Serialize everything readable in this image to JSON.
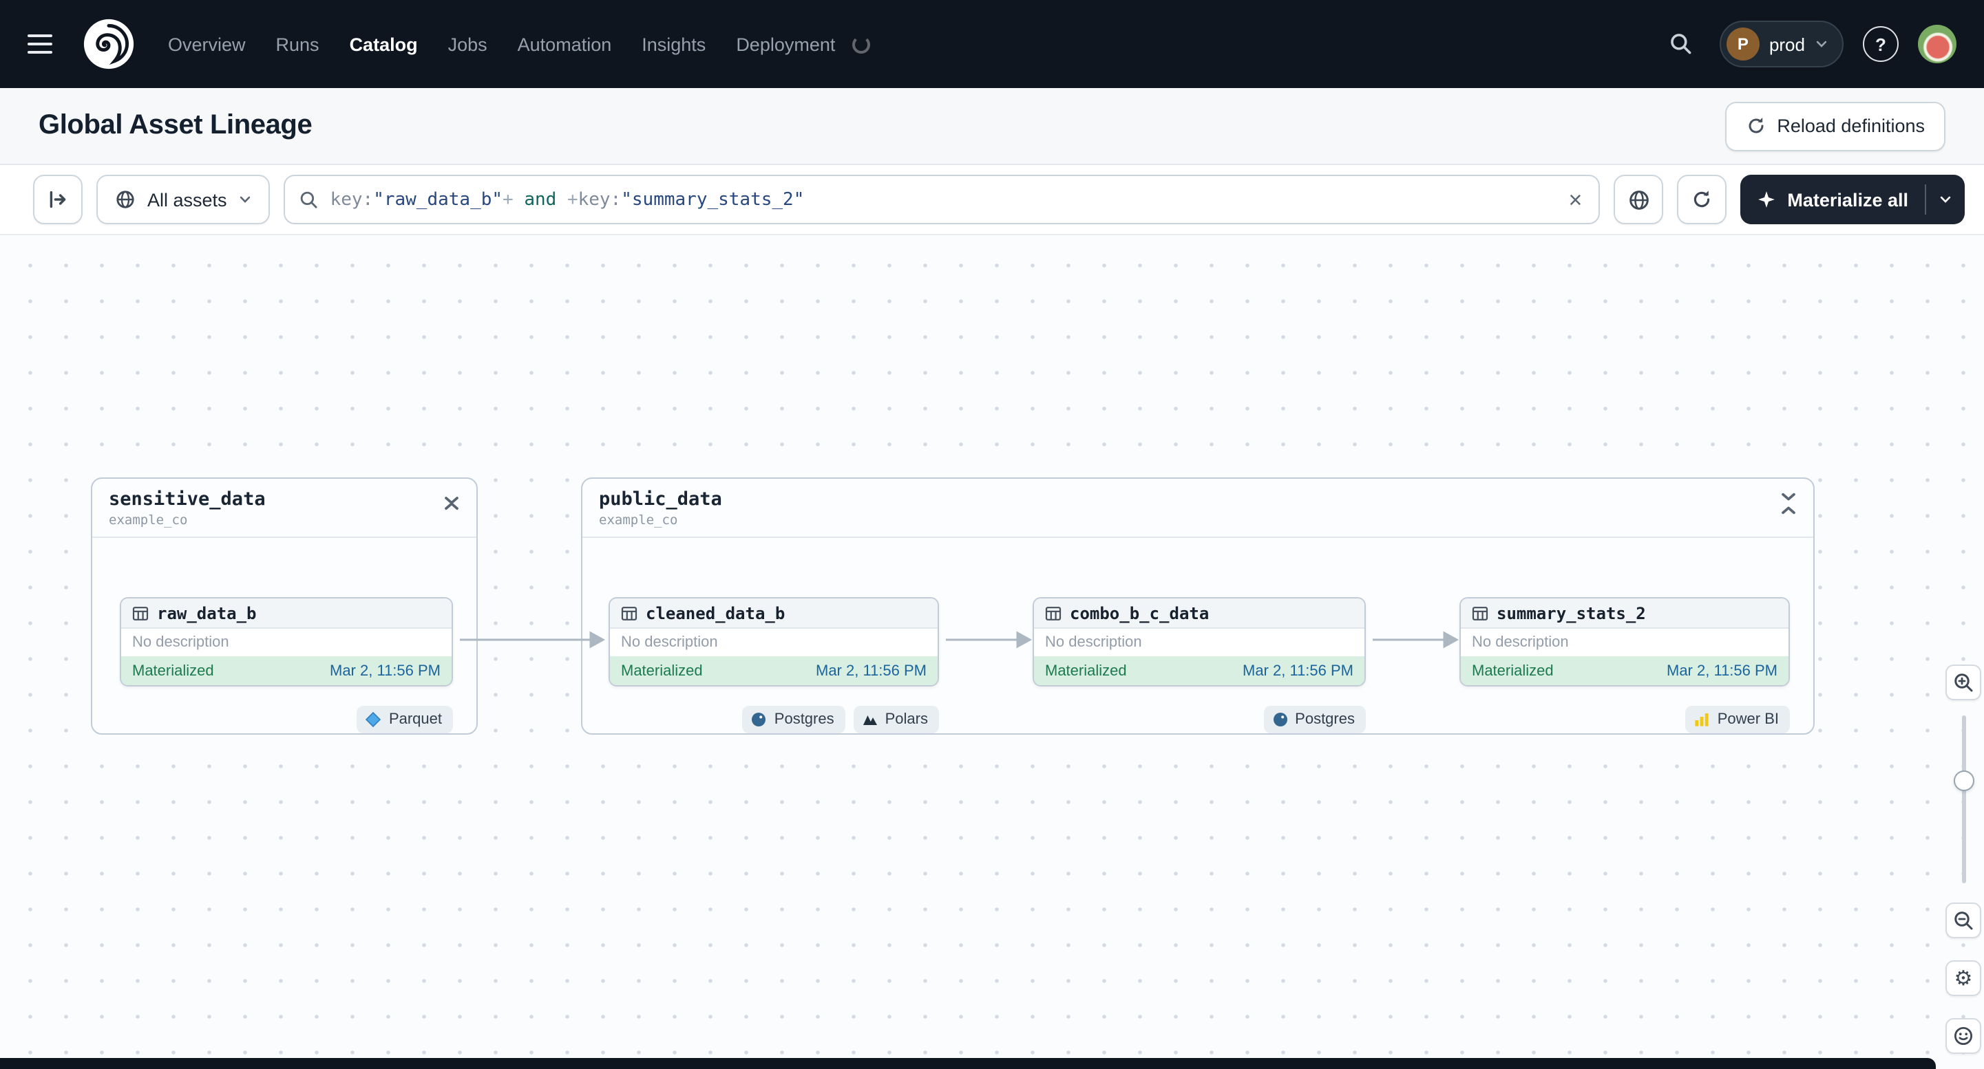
{
  "icons": {
    "close": "×",
    "help": "?",
    "gear": "⚙"
  },
  "navbar": {
    "items": [
      {
        "label": "Overview"
      },
      {
        "label": "Runs"
      },
      {
        "label": "Catalog"
      },
      {
        "label": "Jobs"
      },
      {
        "label": "Automation"
      },
      {
        "label": "Insights"
      },
      {
        "label": "Deployment"
      }
    ],
    "deployment": {
      "initial": "P",
      "label": "prod"
    }
  },
  "header": {
    "title": "Global Asset Lineage",
    "reload_label": "Reload definitions"
  },
  "toolbar": {
    "filter_label": "All assets",
    "query": {
      "parts": [
        {
          "text": "key:"
        },
        {
          "text": "\"raw_data_b\""
        },
        {
          "text": "+"
        },
        {
          "text": " and "
        },
        {
          "text": "+"
        },
        {
          "text": "key:"
        },
        {
          "text": "\"summary_stats_2\""
        }
      ]
    },
    "materialize_label": "Materialize all"
  },
  "graph": {
    "groups": [
      {
        "name": "sensitive_data",
        "location": "example_co",
        "assets": [
          {
            "name": "raw_data_b",
            "description": "No description",
            "status": "Materialized",
            "timestamp": "Mar 2, 11:56 PM",
            "tags": [
              {
                "label": "Parquet"
              }
            ]
          }
        ]
      },
      {
        "name": "public_data",
        "location": "example_co",
        "assets": [
          {
            "name": "cleaned_data_b",
            "description": "No description",
            "status": "Materialized",
            "timestamp": "Mar 2, 11:56 PM",
            "tags": [
              {
                "label": "Postgres"
              },
              {
                "label": "Polars"
              }
            ]
          },
          {
            "name": "combo_b_c_data",
            "description": "No description",
            "status": "Materialized",
            "timestamp": "Mar 2, 11:56 PM",
            "tags": [
              {
                "label": "Postgres"
              }
            ]
          },
          {
            "name": "summary_stats_2",
            "description": "No description",
            "status": "Materialized",
            "timestamp": "Mar 2, 11:56 PM",
            "tags": [
              {
                "label": "Power BI"
              }
            ]
          }
        ]
      }
    ]
  }
}
